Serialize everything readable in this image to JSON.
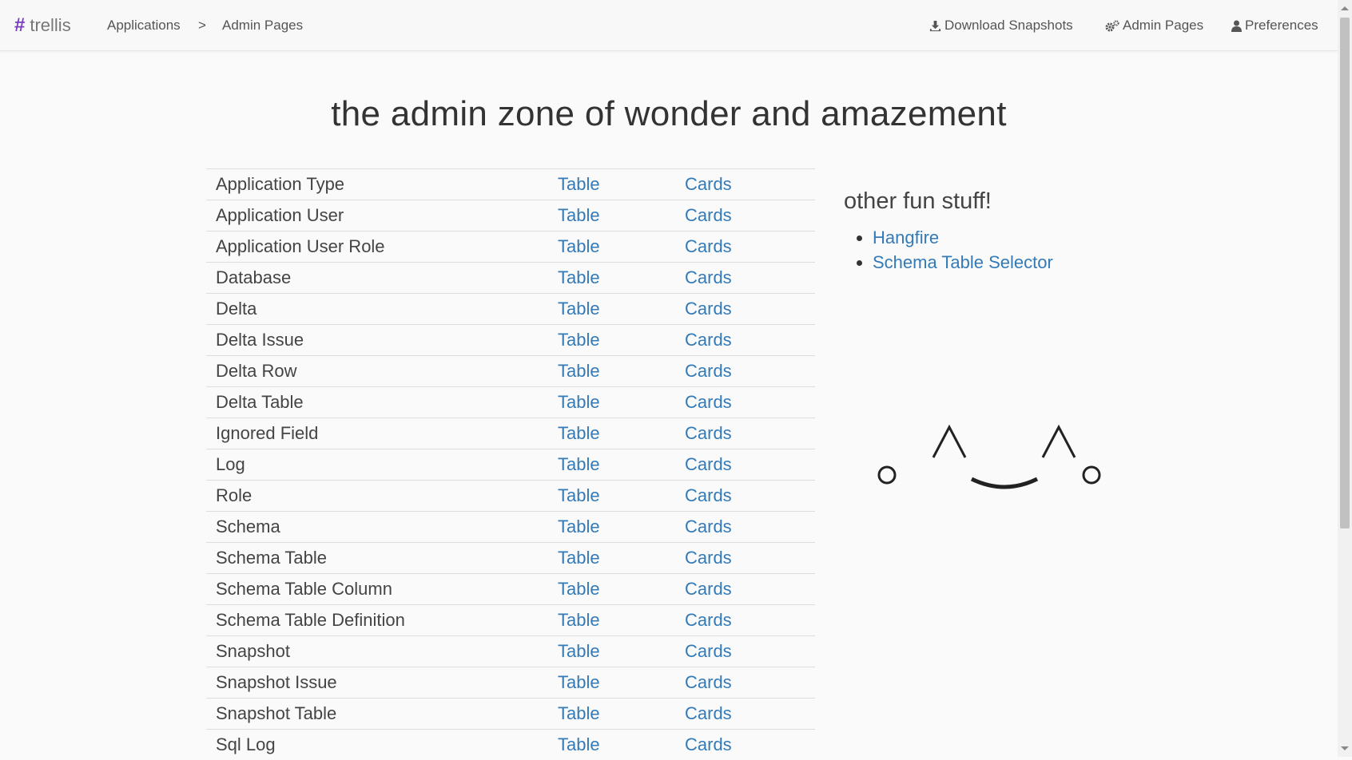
{
  "navbar": {
    "brand_symbol": "#",
    "brand": "trellis",
    "breadcrumb": [
      "Applications",
      ">",
      "Admin Pages"
    ],
    "links": [
      {
        "label": "Download Snapshots",
        "icon": "download-icon"
      },
      {
        "label": "Admin Pages",
        "icon": "cogs-icon"
      },
      {
        "label": "Preferences",
        "icon": "user-icon"
      }
    ]
  },
  "page": {
    "title": "the admin zone of wonder and amazement",
    "rows": [
      {
        "name": "Application Type",
        "table": "Table",
        "cards": "Cards"
      },
      {
        "name": "Application User",
        "table": "Table",
        "cards": "Cards"
      },
      {
        "name": "Application User Role",
        "table": "Table",
        "cards": "Cards"
      },
      {
        "name": "Database",
        "table": "Table",
        "cards": "Cards"
      },
      {
        "name": "Delta",
        "table": "Table",
        "cards": "Cards"
      },
      {
        "name": "Delta Issue",
        "table": "Table",
        "cards": "Cards"
      },
      {
        "name": "Delta Row",
        "table": "Table",
        "cards": "Cards"
      },
      {
        "name": "Delta Table",
        "table": "Table",
        "cards": "Cards"
      },
      {
        "name": "Ignored Field",
        "table": "Table",
        "cards": "Cards"
      },
      {
        "name": "Log",
        "table": "Table",
        "cards": "Cards"
      },
      {
        "name": "Role",
        "table": "Table",
        "cards": "Cards"
      },
      {
        "name": "Schema",
        "table": "Table",
        "cards": "Cards"
      },
      {
        "name": "Schema Table",
        "table": "Table",
        "cards": "Cards"
      },
      {
        "name": "Schema Table Column",
        "table": "Table",
        "cards": "Cards"
      },
      {
        "name": "Schema Table Definition",
        "table": "Table",
        "cards": "Cards"
      },
      {
        "name": "Snapshot",
        "table": "Table",
        "cards": "Cards"
      },
      {
        "name": "Snapshot Issue",
        "table": "Table",
        "cards": "Cards"
      },
      {
        "name": "Snapshot Table",
        "table": "Table",
        "cards": "Cards"
      },
      {
        "name": "Sql Log",
        "table": "Table",
        "cards": "Cards"
      }
    ]
  },
  "sidebar": {
    "title": "other fun stuff!",
    "links": [
      "Hangfire",
      "Schema Table Selector"
    ]
  },
  "colors": {
    "brand_accent": "#7a3fc0",
    "link": "#337ab7"
  }
}
